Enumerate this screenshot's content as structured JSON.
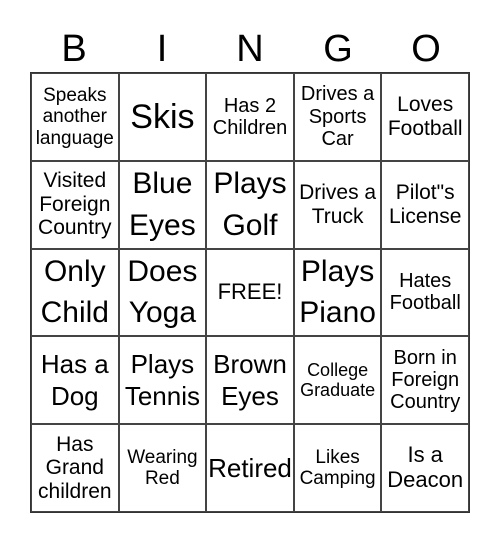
{
  "header": [
    "B",
    "I",
    "N",
    "G",
    "O"
  ],
  "cells": [
    [
      "Speaks another language",
      "Skis",
      "Has 2 Children",
      "Drives a Sports Car",
      "Loves Football"
    ],
    [
      "Visited Foreign Country",
      "Blue Eyes",
      "Plays Golf",
      "Drives a Truck",
      "Pilot\"s License"
    ],
    [
      "Only Child",
      "Does Yoga",
      "FREE!",
      "Plays Piano",
      "Hates Football"
    ],
    [
      "Has a Dog",
      "Plays Tennis",
      "Brown Eyes",
      "College Graduate",
      "Born in Foreign Country"
    ],
    [
      "Has Grand children",
      "Wearing Red",
      "Retired",
      "Likes Camping",
      "Is a Deacon"
    ]
  ]
}
